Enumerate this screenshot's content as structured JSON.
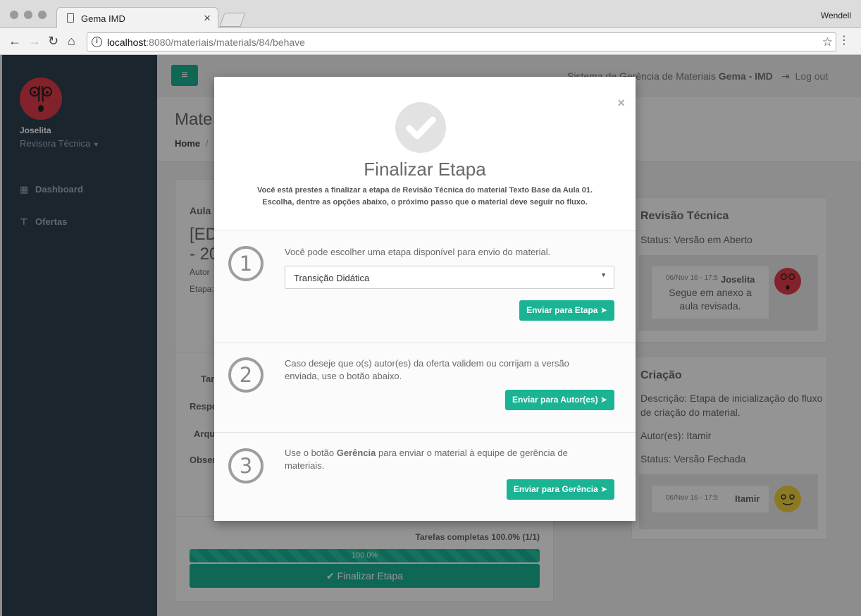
{
  "browser": {
    "tab_title": "Gema IMD",
    "profile": "Wendell",
    "url_host": "localhost",
    "url_path": ":8080/materiais/materials/84/behave"
  },
  "sidebar": {
    "user_name": "Joselita",
    "user_role": "Revisora Técnica",
    "items": [
      {
        "label": "Dashboard",
        "icon": "grid-icon"
      },
      {
        "label": "Ofertas",
        "icon": "signpost-icon"
      }
    ]
  },
  "topbar": {
    "system_title_prefix": "Sistema de Gerência de Materiais ",
    "system_title_bold": "Gema - IMD",
    "logout": "Log out"
  },
  "heading": {
    "title": "Mate",
    "breadcrumb_home": "Home",
    "breadcrumb_sep": "/"
  },
  "main_card": {
    "lesson": "Aula",
    "title_line1": "[ED",
    "title_line2": "- 20",
    "autor_label": "Autor",
    "etapa_label": "Etapa:",
    "task_labels": [
      "Tar",
      "Respo",
      "Arqu",
      "Obser"
    ],
    "progress_label": "Tarefas completas 100.0% (1/1)",
    "progress_text": "100.0%",
    "progress_value": 1.0,
    "finalize_button": "Finalizar Etapa"
  },
  "timeline": {
    "revisao": {
      "title": "Revisão Técnica",
      "status": "Status: Versão em Aberto",
      "message": {
        "time": "06/Nov 16 - 17:5",
        "author": "Joselita",
        "text_line1": "Segue em anexo a",
        "text_line2": "aula revisada."
      }
    },
    "criacao": {
      "title": "Criação",
      "desc_line1": "Descrição: Etapa de inicialização do fluxo",
      "desc_line2": "de criação do material.",
      "authors": "Autor(es): Itamir",
      "status": "Status: Versão Fechada",
      "message": {
        "time": "06/Nov 16 - 17:5",
        "author": "Itamir"
      }
    }
  },
  "modal": {
    "close": "×",
    "title": "Finalizar Etapa",
    "subtitle_line1": "Você está prestes a finalizar a etapa de Revisão Técnica do material Texto Base da Aula 01.",
    "subtitle_line2": "Escolha, dentre as opções abaixo, o próximo passo que o material deve seguir no fluxo.",
    "steps": [
      {
        "number": "1",
        "text": "Você pode escolher uma etapa disponível para envio do material.",
        "select_value": "Transição Didática",
        "button": "Enviar para Etapa"
      },
      {
        "number": "2",
        "text_line1": "Caso deseje que o(s) autor(es) da oferta validem ou corrijam a versão",
        "text_line2": "enviada, use o botão abaixo.",
        "button": "Enviar para Autor(es)"
      },
      {
        "number": "3",
        "text_pre": "Use o botão ",
        "text_bold": "Gerência",
        "text_post": " para enviar o material à equipe de gerência de",
        "text_line2": "materiais.",
        "button": "Enviar para Gerência"
      }
    ]
  },
  "colors": {
    "accent": "#1ab394",
    "sidebar": "#2f4050",
    "avatar_red": "#e03c4b",
    "avatar_yellow": "#f2d23c"
  }
}
